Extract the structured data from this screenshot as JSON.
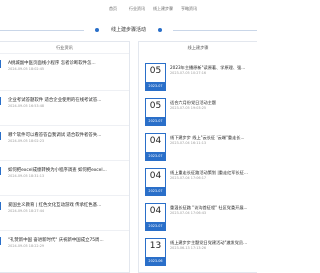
{
  "nav": {
    "links": [
      "首页",
      "行业资讯",
      "线上建步骤",
      "亨略资讯"
    ]
  },
  "section": {
    "title": "线上建步骤活动"
  },
  "left_panel": {
    "title": "行业资讯",
    "items": [
      {
        "title": "A桃城副中医页面线小程序 怎者诊断软件怎...",
        "date": "2024-09-05 18:02:45"
      },
      {
        "title": "企业考试答题软件 适合企业使用的在线考试答...",
        "date": "2024-09-05 16:53:48"
      },
      {
        "title": "哪个软件可以看答答自我调试 适合软件者答失...",
        "date": "2024-09-05 18:02:23"
      },
      {
        "title": "如何把excel成绩转换为小程序调查 如何把excel...",
        "date": "2024-09-05 18:31:13"
      },
      {
        "title": "爱国主义教育 | 红色文化互动游戏 传承红色基...",
        "date": "2024-09-05 18:27:44"
      },
      {
        "title": "\"礼赞新中国 奋进新时代\" 庆祝新中国成立75周...",
        "date": "2024-09-05 18:22:29"
      }
    ]
  },
  "right_panel": {
    "title": "线上建步骤",
    "items": [
      {
        "day": "05",
        "ym": "2023-07",
        "title": "2023年主播原新\"读原著、学原理、强...",
        "date": "2023-07-05 10:27:16"
      },
      {
        "day": "05",
        "ym": "2023-07",
        "title": "适合六月份党日活动主题",
        "date": "2023-07-05 19:03:25"
      },
      {
        "day": "04",
        "ym": "2023-07",
        "title": "线下建步步 线上\"云长征 '云端\"重走长...",
        "date": "2023-07-04 16:11:13"
      },
      {
        "day": "04",
        "ym": "2023-07",
        "title": "线上重走长征路活动策划 |重走红军长征...",
        "date": "2023-07-04 17:06:17"
      },
      {
        "day": "04",
        "ym": "2023-07",
        "title": "重温长征路 \"访沟首征程\" 社区党委开展...",
        "date": "2023-07-04 17:06:43"
      },
      {
        "day": "13",
        "ym": "2023-06",
        "title": "线上建步步主题党日党建活动\"激发党员...",
        "date": "2023-06-13 17:13:26"
      }
    ]
  }
}
